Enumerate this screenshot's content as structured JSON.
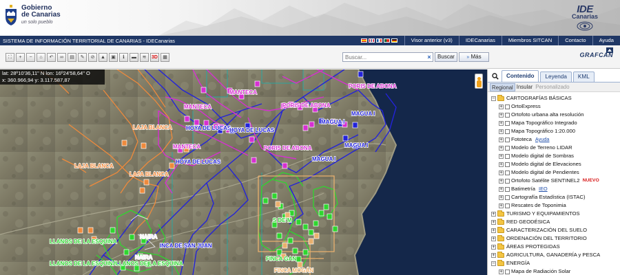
{
  "header": {
    "org_line1": "Gobierno",
    "org_line2": "de Canarias",
    "org_slogan": "un solo pueblo",
    "ide_logo_main": "IDE",
    "ide_logo_sub": "Canarias"
  },
  "navbar": {
    "site_title": "SISTEMA DE INFORMACIÓN TERRITORIAL DE CANARIAS - IDECanarias",
    "links": [
      "Visor anterior (v3)",
      "IDECanarias",
      "Miembros SITCAN",
      "Contacto",
      "Ayuda"
    ]
  },
  "toolbar": {
    "search_placeholder": "Buscar...",
    "search_button": "Buscar",
    "more_button": "Más",
    "three_d_label": "3D",
    "brand": "GRAFCAN"
  },
  "map": {
    "coords_line1": "lat:  28º10'36,11\" N   lon: 16º24'58,64\" O",
    "coords_line2": "x: 360.966,94  y: 3.117.587,87",
    "labels": {
      "manteca": "MANTECA",
      "poris_abona": "PORIS DE ABONA",
      "hoya_lucas": "HOYA DE LUCAS",
      "magua_i": "MAGUA I",
      "laja_blanca": "LAJA BLANCA",
      "llanos_esquina": "LLANOS DE LA ESQUINA",
      "naira": "NAIRA",
      "inca_san_juan": "INCA DE SAN JUAN",
      "finca_mogan": "FINCA MOGÁN",
      "s_e_m": "S   DE  M",
      "finca_gan": "FINCA    GAN"
    },
    "colors": {
      "blue": "#2323d9",
      "magenta": "#d62fd1",
      "orange": "#ee8a3c",
      "green": "#2fd62f",
      "teal": "#2aa6a0",
      "peach": "#e9b06e",
      "sea": "#14274a"
    }
  },
  "panel": {
    "tabs": [
      "Contenido",
      "Leyenda",
      "KML"
    ],
    "active_tab": "Contenido",
    "subtabs": [
      "Regional",
      "Insular",
      "Personalizado"
    ],
    "tree": [
      {
        "type": "folder",
        "label": "CARTOGRAFÍAS BÁSICAS",
        "expanded": true
      },
      {
        "type": "layer",
        "label": "OrtoExpress"
      },
      {
        "type": "layer",
        "label": "Ortofoto urbana alta resolución"
      },
      {
        "type": "layer",
        "label": "Mapa Topográfico Integrado"
      },
      {
        "type": "layer",
        "label": "Mapa Topográfico 1:20.000"
      },
      {
        "type": "layer",
        "label": "Fototeca",
        "help": "Ayuda"
      },
      {
        "type": "layer",
        "label": "Modelo de Terreno LIDAR"
      },
      {
        "type": "layer",
        "label": "Modelo digital de Sombras"
      },
      {
        "type": "layer",
        "label": "Modelo digital de Elevaciones"
      },
      {
        "type": "layer",
        "label": "Modelo digital de Pendientes"
      },
      {
        "type": "layer",
        "label": "Ortofoto Satélite SENTINEL2",
        "badge": "NUEVO"
      },
      {
        "type": "layer",
        "label": "Batimetría",
        "help": "IEO"
      },
      {
        "type": "layer",
        "label": "Cartografía Estadística (ISTAC)"
      },
      {
        "type": "layer",
        "label": "Rescates de Toponimia"
      },
      {
        "type": "folder",
        "label": "TURISMO Y EQUIPAMIENTOS",
        "expanded": false
      },
      {
        "type": "folder",
        "label": "RED GEODÉSICA",
        "expanded": false
      },
      {
        "type": "folder",
        "label": "CARACTERIZACIÓN DEL SUELO",
        "expanded": false
      },
      {
        "type": "folder",
        "label": "ORDENACIÓN DEL TERRITORIO",
        "expanded": false
      },
      {
        "type": "folder",
        "label": "ÁREAS PROTEGIDAS",
        "expanded": false
      },
      {
        "type": "folder",
        "label": "AGRICULTURA, GANADERÍA y PESCA",
        "expanded": false
      },
      {
        "type": "folder",
        "label": "ENERGÍA",
        "expanded": true
      },
      {
        "type": "layer",
        "label": "Mapa de Radiación Solar"
      }
    ]
  }
}
